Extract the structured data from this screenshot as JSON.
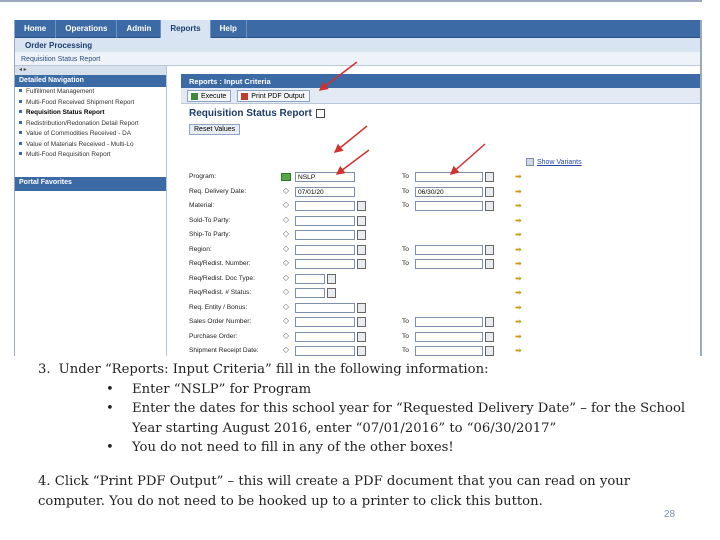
{
  "topnav": {
    "tabs": [
      "Home",
      "Operations",
      "Admin",
      "Reports",
      "Help"
    ],
    "active": "Reports"
  },
  "subnav": {
    "label": "Order Processing"
  },
  "breadcrumb": {
    "label": "Requisition Status Report"
  },
  "leftnav": {
    "header": "Detailed Navigation",
    "items": [
      "Fulfillment Management",
      "Multi-Food Received Shipment Report",
      "Requisition Status Report",
      "Redistribution/Redonation Detail Report",
      "Value of Commodities Received - DA",
      "Value of Materials Received - Multi-Lo",
      "Multi-Food Requisition Report"
    ],
    "selected_index": 2,
    "portal_favorites": "Portal Favorites"
  },
  "panel": {
    "title": "Reports : Input Criteria",
    "execute_label": "Execute",
    "print_pdf_label": "Print PDF Output",
    "form_title": "Requisition Status Report",
    "reset_label": "Reset Values",
    "show_variants_label": "Show Variants",
    "to_label": "To",
    "fields": [
      {
        "label": "Program:",
        "value": "NSLP",
        "has_to": true,
        "to_value": ""
      },
      {
        "label": "Req. Delivery Date:",
        "value": "07/01/20",
        "has_to": true,
        "to_value": "06/30/20"
      },
      {
        "label": "Material:",
        "value": "",
        "has_to": true,
        "to_value": ""
      },
      {
        "label": "Sold-To Party:",
        "value": "",
        "has_to": false
      },
      {
        "label": "Ship-To Party:",
        "value": "",
        "has_to": false
      },
      {
        "label": "Region:",
        "value": "",
        "has_to": true,
        "to_value": ""
      },
      {
        "label": "Req/Redist. Number:",
        "value": "",
        "has_to": true,
        "to_value": ""
      },
      {
        "label": "Req/Redist. Doc Type:",
        "value": "",
        "has_to": false
      },
      {
        "label": "Req/Redist. # Status:",
        "value": "",
        "has_to": false
      },
      {
        "label": "Req. Entity / Bonus:",
        "value": "",
        "has_to": false
      },
      {
        "label": "Sales Order Number:",
        "value": "",
        "has_to": true,
        "to_value": ""
      },
      {
        "label": "Purchase Order:",
        "value": "",
        "has_to": true,
        "to_value": ""
      },
      {
        "label": "Shipment Receipt Date:",
        "value": "",
        "has_to": true,
        "to_value": ""
      }
    ]
  },
  "instructions": {
    "step3_num": "3.",
    "step3": "Under “Reports: Input Criteria” fill in the following information:",
    "bullets": [
      "Enter “NSLP” for Program",
      "Enter the dates for this school year for “Requested Delivery Date” – for the School Year starting August 2016, enter “07/01/2016” to “06/30/2017”",
      "You do not need to fill in any of the other boxes!"
    ],
    "step4": "4.  Click “Print PDF Output” – this will create a PDF document that you can read on your computer.   You do not need to be hooked up to a printer to click this button."
  },
  "page_number": "28",
  "colors": {
    "nav_blue": "#3c6aa5",
    "arrow_red": "#d0312d",
    "text": "#222222"
  }
}
